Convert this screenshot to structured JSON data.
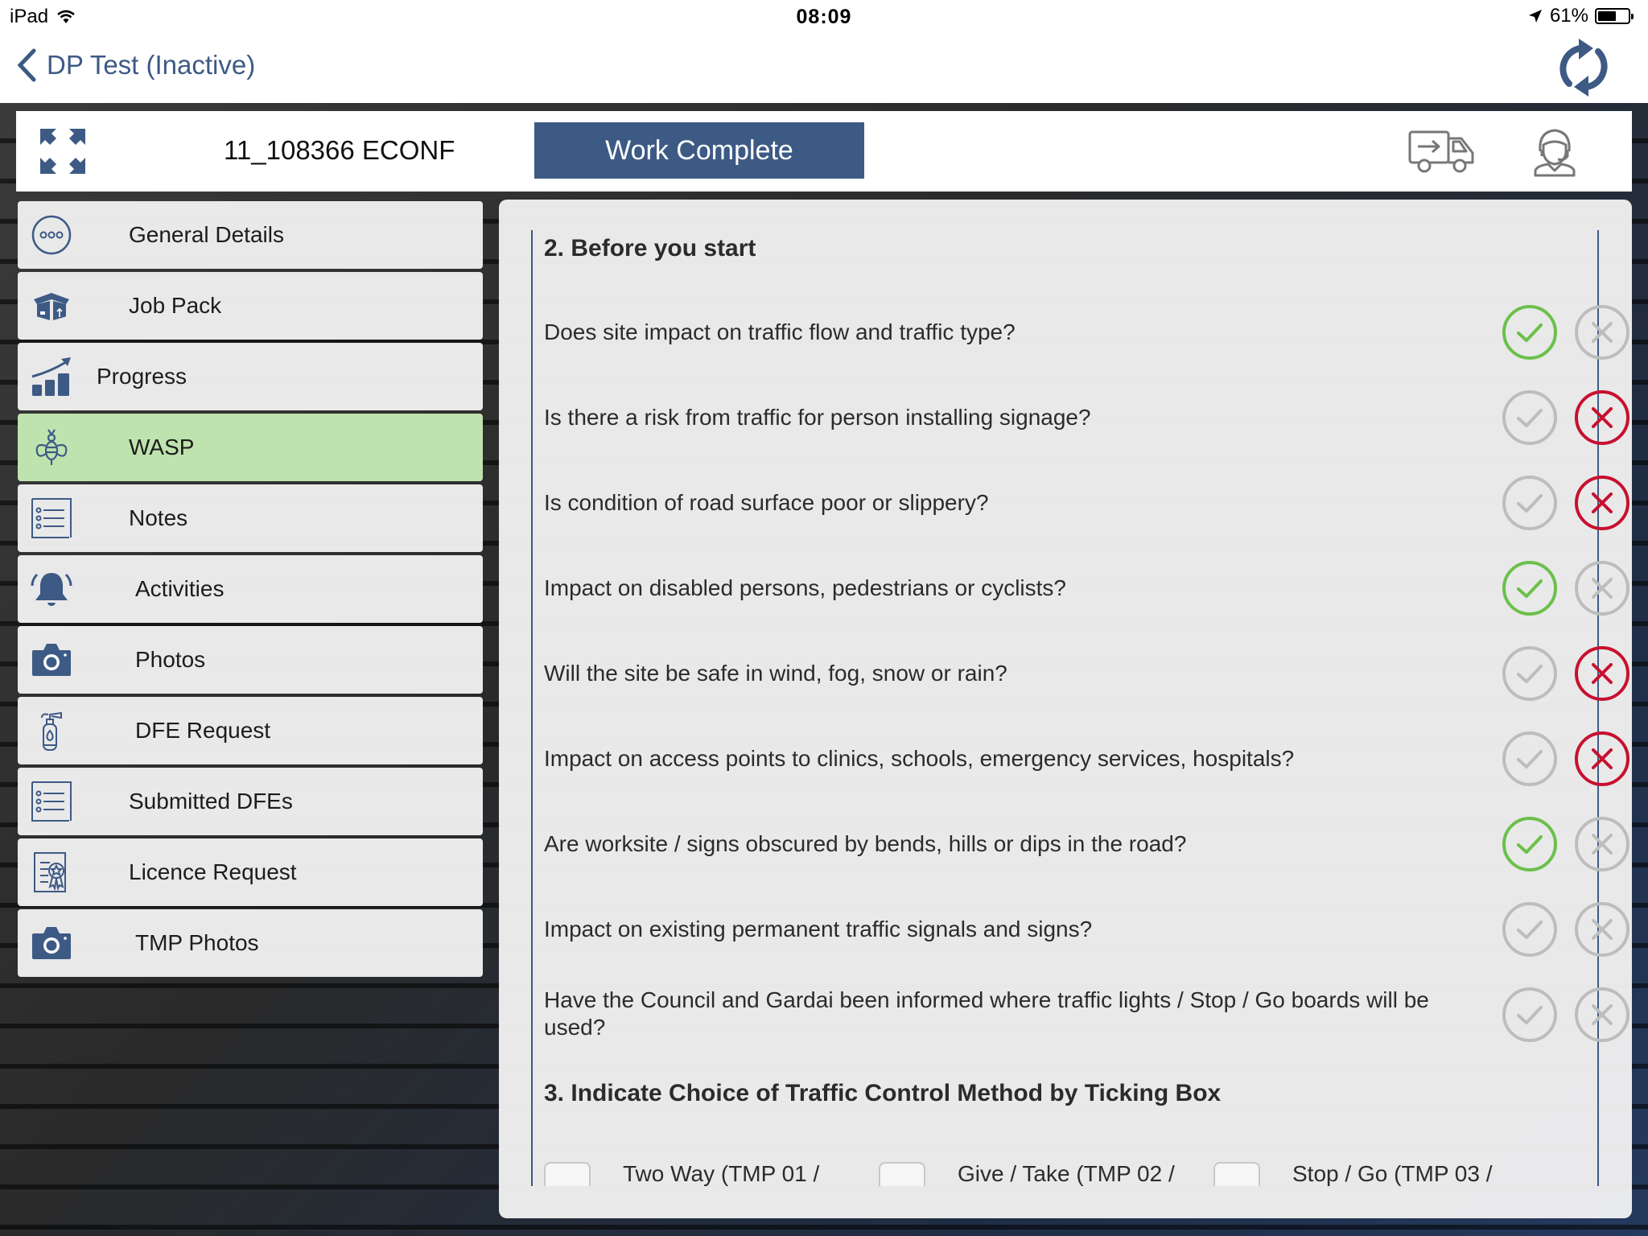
{
  "status_bar": {
    "device": "iPad",
    "time": "08:09",
    "battery_percent": "61%",
    "battery_level": 0.61
  },
  "nav": {
    "back_label": "DP Test (Inactive)",
    "refresh_icon": "refresh-icon"
  },
  "job_bar": {
    "job_id": "11_108366 ECONF",
    "work_complete_label": "Work Complete"
  },
  "sidebar": {
    "items": [
      {
        "label": "General Details",
        "icon": "more-circle-icon",
        "active": false
      },
      {
        "label": "Job Pack",
        "icon": "box-icon",
        "active": false
      },
      {
        "label": "Progress",
        "icon": "chart-growth-icon",
        "active": false
      },
      {
        "label": "WASP",
        "icon": "bee-icon",
        "active": true
      },
      {
        "label": "Notes",
        "icon": "list-icon",
        "active": false
      },
      {
        "label": "Activities",
        "icon": "bell-icon",
        "active": false
      },
      {
        "label": "Photos",
        "icon": "camera-icon",
        "active": false
      },
      {
        "label": "DFE Request",
        "icon": "extinguisher-icon",
        "active": false
      },
      {
        "label": "Submitted DFEs",
        "icon": "list-icon",
        "active": false
      },
      {
        "label": "Licence Request",
        "icon": "certificate-icon",
        "active": false
      },
      {
        "label": "TMP Photos",
        "icon": "camera-icon",
        "active": false
      }
    ]
  },
  "colors": {
    "brand": "#3d5a85",
    "active_item": "#bfe3ae",
    "yes_selected": "#6cc04a",
    "no_selected": "#c8102e",
    "unselected": "#bdbdbd"
  },
  "form": {
    "section2_title": "2. Before you start",
    "questions": [
      {
        "text": "Does site impact on traffic flow and traffic type?",
        "answer": "yes"
      },
      {
        "text": "Is there a risk from traffic for person installing signage?",
        "answer": "no"
      },
      {
        "text": "Is condition of road surface poor or slippery?",
        "answer": "no"
      },
      {
        "text": "Impact on disabled persons, pedestrians or cyclists?",
        "answer": "yes"
      },
      {
        "text": "Will the site be safe in wind, fog, snow or rain?",
        "answer": "no"
      },
      {
        "text": "Impact on access points to clinics, schools, emergency services, hospitals?",
        "answer": "no"
      },
      {
        "text": "Are worksite / signs obscured by bends, hills or dips in the road?",
        "answer": "yes"
      },
      {
        "text": "Impact on existing permanent traffic signals and signs?",
        "answer": "none"
      },
      {
        "text": "Have the Council and Gardai been informed where traffic lights / Stop / Go boards will be used?",
        "answer": "none"
      }
    ],
    "section3_title": "3. Indicate Choice of Traffic Control Method by Ticking Box",
    "methods": [
      {
        "label": "Two Way (TMP 01 /",
        "checked": false
      },
      {
        "label": "Give / Take (TMP 02 /",
        "checked": false
      },
      {
        "label": "Stop / Go (TMP 03 /",
        "checked": false
      }
    ]
  }
}
